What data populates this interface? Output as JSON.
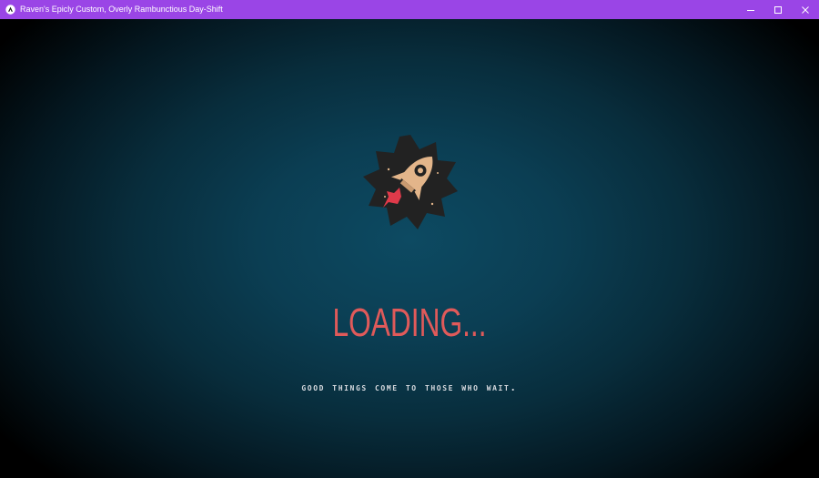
{
  "window": {
    "title": "Raven's Epicly Custom, Overly Rambunctious Day-Shift",
    "titlebar_color": "#9a45e6",
    "icons": {
      "app": "app-logo-icon",
      "minimize": "minimize-icon",
      "maximize": "maximize-icon",
      "close": "close-icon"
    }
  },
  "screen": {
    "logo_icon": "rocket-badge-icon",
    "loading_text": "LOADING...",
    "tagline": "GOOD THINGS COME TO THOSE WHO WAIT.",
    "colors": {
      "background_center": "#0d4a62",
      "loading_text": "#e05a5a",
      "tagline": "#d8dbe0",
      "rocket": "#e3b58a",
      "flame": "#e03a4a",
      "badge": "#222222"
    }
  }
}
